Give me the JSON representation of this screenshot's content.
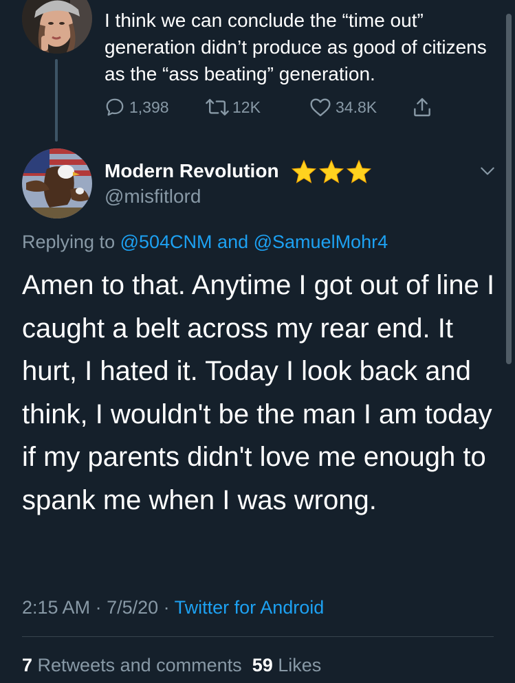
{
  "prev_tweet": {
    "text": "I think we can conclude the “time out” generation didn’t produce as good of citizens as the “ass beating” generation.",
    "reply_count": "1,398",
    "retweet_count": "12K",
    "like_count": "34.8K"
  },
  "tweet": {
    "display_name": "Modern Revolution",
    "name_emoji": "⭐⭐⭐",
    "handle": "@misfitlord",
    "replying_prefix": "Replying to ",
    "replying_user1": "@504CNM",
    "replying_and": " and ",
    "replying_user2": "@SamuelMohr4",
    "body": "Amen to that. Anytime I got out of line I caught a belt across my rear end. It hurt, I hated it. Today I look back and think, I wouldn't be the man I am today if my parents didn't love me enough to spank me when I was wrong.",
    "time": "2:15 AM",
    "date": "7/5/20",
    "source": "Twitter for Android",
    "retweets_comments_count": "7",
    "retweets_comments_label": "Retweets and comments",
    "likes_count": "59",
    "likes_label": "Likes"
  },
  "colors": {
    "background": "#15202b",
    "secondary_text": "#8899a6",
    "link": "#1da1f2",
    "star": "#ffd21f"
  }
}
